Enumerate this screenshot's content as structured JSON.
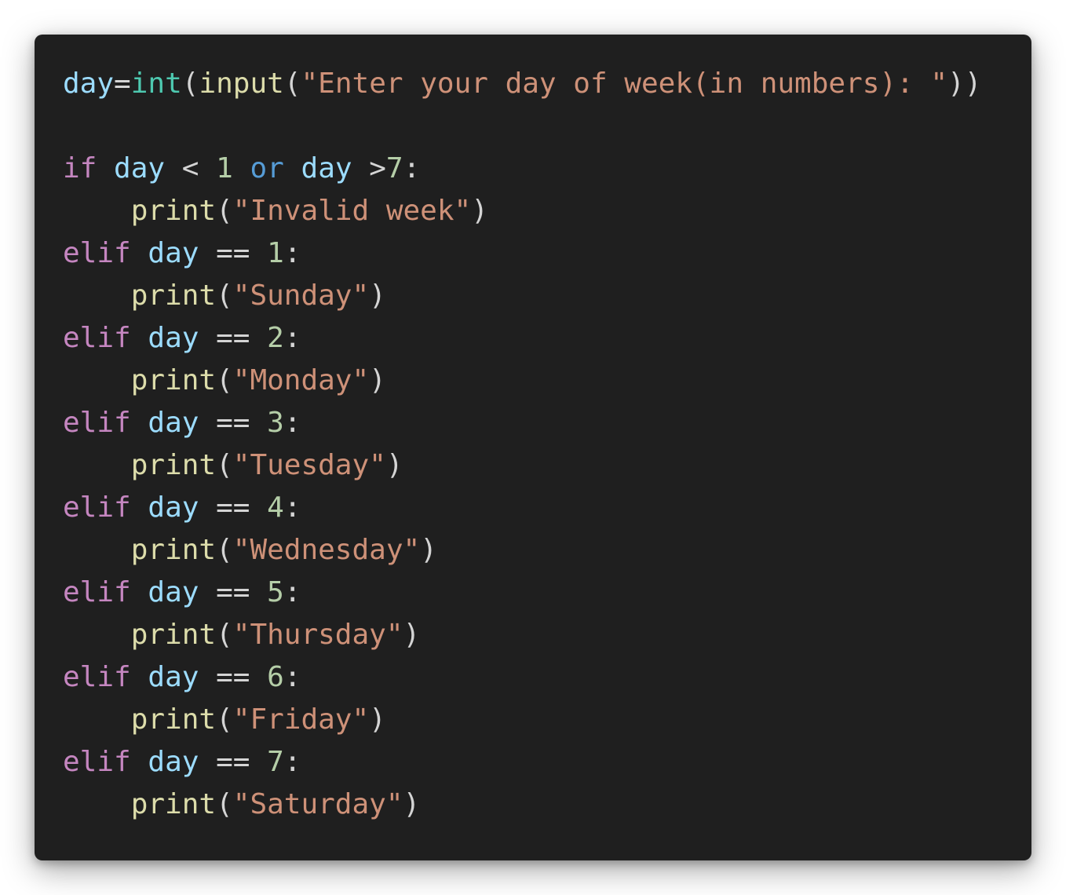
{
  "colors": {
    "background": "#1f1f1f",
    "keyword": "#c586c0",
    "variable": "#9cdcfe",
    "builtin_type": "#4ec9b0",
    "function": "#dcdcaa",
    "string": "#ce9178",
    "number": "#b5cea8",
    "operator_keyword": "#569cd6",
    "plain": "#d4d4d4"
  },
  "code": {
    "lines": [
      [
        {
          "t": "day",
          "k": "var"
        },
        {
          "t": "=",
          "k": "plain"
        },
        {
          "t": "int",
          "k": "builtin-type"
        },
        {
          "t": "(",
          "k": "plain"
        },
        {
          "t": "input",
          "k": "func"
        },
        {
          "t": "(",
          "k": "plain"
        },
        {
          "t": "\"Enter your day of week(in numbers): \"",
          "k": "string"
        },
        {
          "t": "))",
          "k": "plain"
        }
      ],
      [],
      [
        {
          "t": "if",
          "k": "keyword"
        },
        {
          "t": " ",
          "k": "plain"
        },
        {
          "t": "day",
          "k": "var"
        },
        {
          "t": " < ",
          "k": "plain"
        },
        {
          "t": "1",
          "k": "number"
        },
        {
          "t": " ",
          "k": "plain"
        },
        {
          "t": "or",
          "k": "op-keyword"
        },
        {
          "t": " ",
          "k": "plain"
        },
        {
          "t": "day",
          "k": "var"
        },
        {
          "t": " >",
          "k": "plain"
        },
        {
          "t": "7",
          "k": "number"
        },
        {
          "t": ":",
          "k": "plain"
        }
      ],
      [
        {
          "t": "    ",
          "k": "plain"
        },
        {
          "t": "print",
          "k": "func"
        },
        {
          "t": "(",
          "k": "plain"
        },
        {
          "t": "\"Invalid week\"",
          "k": "string"
        },
        {
          "t": ")",
          "k": "plain"
        }
      ],
      [
        {
          "t": "elif",
          "k": "keyword"
        },
        {
          "t": " ",
          "k": "plain"
        },
        {
          "t": "day",
          "k": "var"
        },
        {
          "t": " == ",
          "k": "plain"
        },
        {
          "t": "1",
          "k": "number"
        },
        {
          "t": ":",
          "k": "plain"
        }
      ],
      [
        {
          "t": "    ",
          "k": "plain"
        },
        {
          "t": "print",
          "k": "func"
        },
        {
          "t": "(",
          "k": "plain"
        },
        {
          "t": "\"Sunday\"",
          "k": "string"
        },
        {
          "t": ")",
          "k": "plain"
        }
      ],
      [
        {
          "t": "elif",
          "k": "keyword"
        },
        {
          "t": " ",
          "k": "plain"
        },
        {
          "t": "day",
          "k": "var"
        },
        {
          "t": " == ",
          "k": "plain"
        },
        {
          "t": "2",
          "k": "number"
        },
        {
          "t": ":",
          "k": "plain"
        }
      ],
      [
        {
          "t": "    ",
          "k": "plain"
        },
        {
          "t": "print",
          "k": "func"
        },
        {
          "t": "(",
          "k": "plain"
        },
        {
          "t": "\"Monday\"",
          "k": "string"
        },
        {
          "t": ")",
          "k": "plain"
        }
      ],
      [
        {
          "t": "elif",
          "k": "keyword"
        },
        {
          "t": " ",
          "k": "plain"
        },
        {
          "t": "day",
          "k": "var"
        },
        {
          "t": " == ",
          "k": "plain"
        },
        {
          "t": "3",
          "k": "number"
        },
        {
          "t": ":",
          "k": "plain"
        }
      ],
      [
        {
          "t": "    ",
          "k": "plain"
        },
        {
          "t": "print",
          "k": "func"
        },
        {
          "t": "(",
          "k": "plain"
        },
        {
          "t": "\"Tuesday\"",
          "k": "string"
        },
        {
          "t": ")",
          "k": "plain"
        }
      ],
      [
        {
          "t": "elif",
          "k": "keyword"
        },
        {
          "t": " ",
          "k": "plain"
        },
        {
          "t": "day",
          "k": "var"
        },
        {
          "t": " == ",
          "k": "plain"
        },
        {
          "t": "4",
          "k": "number"
        },
        {
          "t": ":",
          "k": "plain"
        }
      ],
      [
        {
          "t": "    ",
          "k": "plain"
        },
        {
          "t": "print",
          "k": "func"
        },
        {
          "t": "(",
          "k": "plain"
        },
        {
          "t": "\"Wednesday\"",
          "k": "string"
        },
        {
          "t": ")",
          "k": "plain"
        }
      ],
      [
        {
          "t": "elif",
          "k": "keyword"
        },
        {
          "t": " ",
          "k": "plain"
        },
        {
          "t": "day",
          "k": "var"
        },
        {
          "t": " == ",
          "k": "plain"
        },
        {
          "t": "5",
          "k": "number"
        },
        {
          "t": ":",
          "k": "plain"
        }
      ],
      [
        {
          "t": "    ",
          "k": "plain"
        },
        {
          "t": "print",
          "k": "func"
        },
        {
          "t": "(",
          "k": "plain"
        },
        {
          "t": "\"Thursday\"",
          "k": "string"
        },
        {
          "t": ")",
          "k": "plain"
        }
      ],
      [
        {
          "t": "elif",
          "k": "keyword"
        },
        {
          "t": " ",
          "k": "plain"
        },
        {
          "t": "day",
          "k": "var"
        },
        {
          "t": " == ",
          "k": "plain"
        },
        {
          "t": "6",
          "k": "number"
        },
        {
          "t": ":",
          "k": "plain"
        }
      ],
      [
        {
          "t": "    ",
          "k": "plain"
        },
        {
          "t": "print",
          "k": "func"
        },
        {
          "t": "(",
          "k": "plain"
        },
        {
          "t": "\"Friday\"",
          "k": "string"
        },
        {
          "t": ")",
          "k": "plain"
        }
      ],
      [
        {
          "t": "elif",
          "k": "keyword"
        },
        {
          "t": " ",
          "k": "plain"
        },
        {
          "t": "day",
          "k": "var"
        },
        {
          "t": " == ",
          "k": "plain"
        },
        {
          "t": "7",
          "k": "number"
        },
        {
          "t": ":",
          "k": "plain"
        }
      ],
      [
        {
          "t": "    ",
          "k": "plain"
        },
        {
          "t": "print",
          "k": "func"
        },
        {
          "t": "(",
          "k": "plain"
        },
        {
          "t": "\"Saturday\"",
          "k": "string"
        },
        {
          "t": ")",
          "k": "plain"
        }
      ]
    ]
  }
}
